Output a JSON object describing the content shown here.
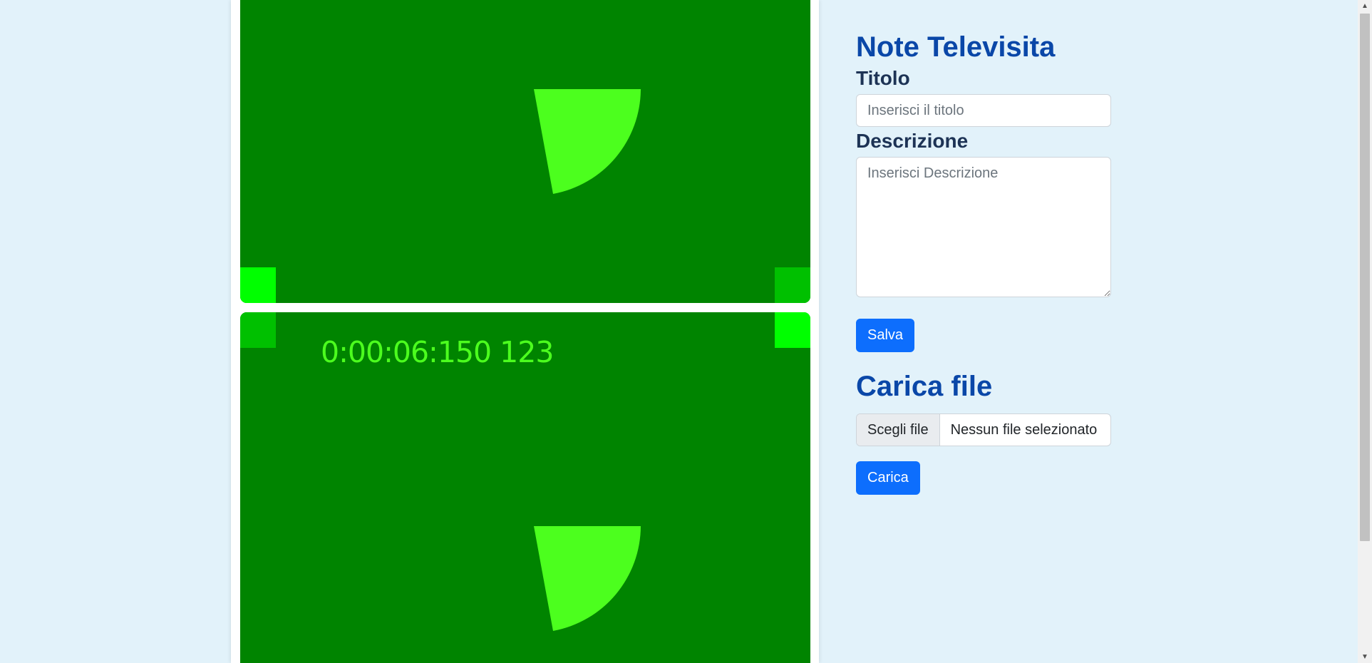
{
  "video": {
    "timecode": "0:00:06:150 123",
    "colors": {
      "background": "#008400",
      "wedge": "#4cff1e",
      "corner_bright": "#00ff00",
      "corner_dim": "#00c000"
    }
  },
  "notes": {
    "title": "Note Televisita",
    "title_label": "Titolo",
    "title_placeholder": "Inserisci il titolo",
    "title_value": "",
    "description_label": "Descrizione",
    "description_placeholder": "Inserisci Descrizione",
    "description_value": "",
    "save_label": "Salva"
  },
  "upload": {
    "title": "Carica file",
    "choose_file_label": "Scegli file",
    "no_file_label": "Nessun file selezionato",
    "upload_label": "Carica"
  },
  "scrollbar": {
    "up_icon": "triangle-up",
    "down_icon": "triangle-down"
  },
  "theme": {
    "page_background": "#e2f2fa",
    "heading_color": "#0a47a8",
    "label_color": "#1d3355",
    "button_color": "#0d6efd"
  }
}
